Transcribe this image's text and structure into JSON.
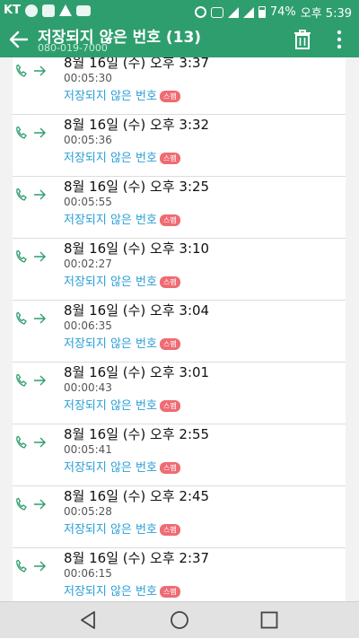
{
  "status_bar": {
    "carrier": "KT",
    "battery": "74%",
    "clock": "오후 5:39"
  },
  "app_bar": {
    "title": "저장되지 않은 번호 (13)",
    "subtitle": "080-019-7000",
    "icons": [
      "back-arrow-icon",
      "trash-icon",
      "more-vert-icon"
    ]
  },
  "calls": [
    {
      "date": "8월 16일 (수) 오후 3:37",
      "duration": "00:05:30",
      "label": "저장되지 않은 번호",
      "badge": "스팸"
    },
    {
      "date": "8월 16일 (수) 오후 3:32",
      "duration": "00:05:36",
      "label": "저장되지 않은 번호",
      "badge": "스팸"
    },
    {
      "date": "8월 16일 (수) 오후 3:25",
      "duration": "00:05:55",
      "label": "저장되지 않은 번호",
      "badge": "스팸"
    },
    {
      "date": "8월 16일 (수) 오후 3:10",
      "duration": "00:02:27",
      "label": "저장되지 않은 번호",
      "badge": "스팸"
    },
    {
      "date": "8월 16일 (수) 오후 3:04",
      "duration": "00:06:35",
      "label": "저장되지 않은 번호",
      "badge": "스팸"
    },
    {
      "date": "8월 16일 (수) 오후 3:01",
      "duration": "00:00:43",
      "label": "저장되지 않은 번호",
      "badge": "스팸"
    },
    {
      "date": "8월 16일 (수) 오후 2:55",
      "duration": "00:05:41",
      "label": "저장되지 않은 번호",
      "badge": "스팸"
    },
    {
      "date": "8월 16일 (수) 오후 2:45",
      "duration": "00:05:28",
      "label": "저장되지 않은 번호",
      "badge": "스팸"
    },
    {
      "date": "8월 16일 (수) 오후 2:37",
      "duration": "00:06:15",
      "label": "저장되지 않은 번호",
      "badge": "스팸"
    }
  ],
  "colors": {
    "brand_green": "#2e9e6e",
    "link_blue": "#2a9fd6",
    "spam_red": "#ef6b73"
  },
  "nav_bar": {
    "icons": [
      "nav-back-icon",
      "nav-home-icon",
      "nav-recent-icon"
    ]
  }
}
